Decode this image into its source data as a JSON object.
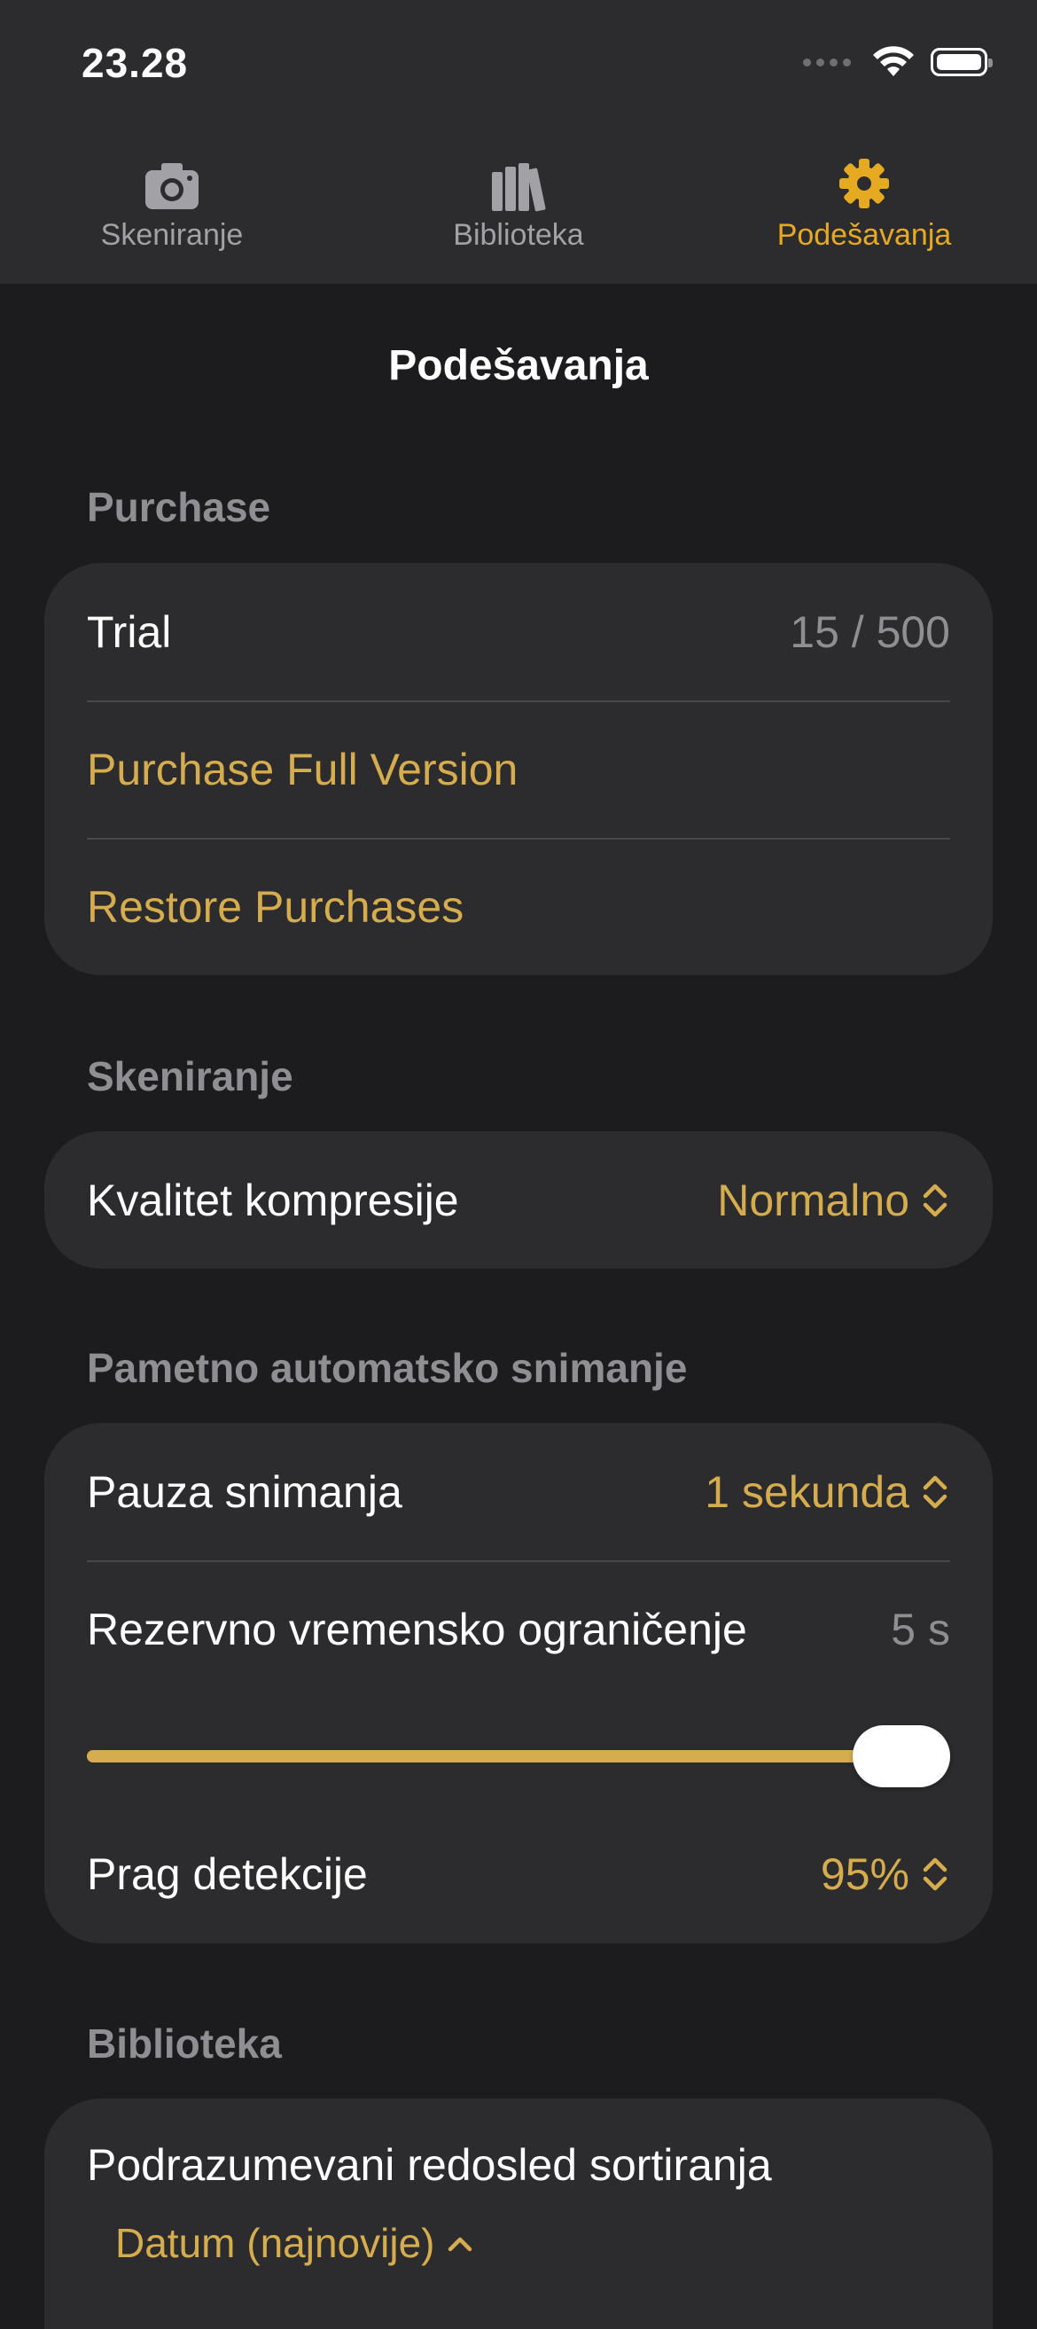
{
  "status_bar": {
    "time": "23.28"
  },
  "tabs": [
    {
      "label": "Skeniranje",
      "icon": "camera-icon",
      "active": false
    },
    {
      "label": "Biblioteka",
      "icon": "books-icon",
      "active": false
    },
    {
      "label": "Podešavanja",
      "icon": "gear-icon",
      "active": true
    }
  ],
  "page_title": "Podešavanja",
  "accent_color": "#d6ad4e",
  "purchase": {
    "header": "Purchase",
    "trial_label": "Trial",
    "trial_value": "15 / 500",
    "purchase_full": "Purchase Full Version",
    "restore": "Restore Purchases"
  },
  "scanning": {
    "header": "Skeniranje",
    "compression_label": "Kvalitet kompresije",
    "compression_value": "Normalno"
  },
  "smart_capture": {
    "header": "Pametno automatsko snimanje",
    "pause_label": "Pauza snimanja",
    "pause_value": "1 sekunda",
    "timeout_label": "Rezervno vremensko ograničenje",
    "timeout_value": "5 s",
    "timeout_fraction": 1.0,
    "threshold_label": "Prag detekcije",
    "threshold_value": "95%"
  },
  "library": {
    "header": "Biblioteka",
    "sort_label": "Podrazumevani redosled sortiranja",
    "sort_value": "Datum (najnovije)"
  }
}
